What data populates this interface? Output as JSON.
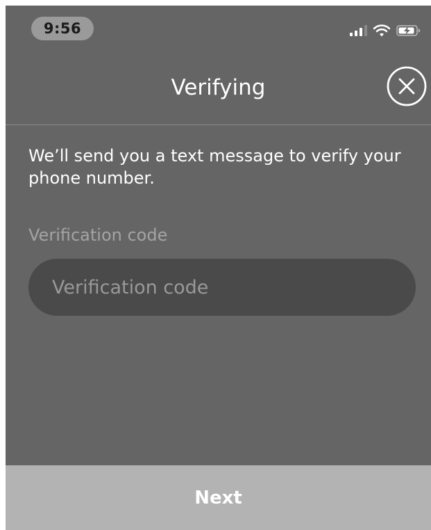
{
  "status_bar": {
    "time": "9:56",
    "icons": [
      "signal-icon",
      "wifi-icon",
      "battery-charging-icon"
    ]
  },
  "header": {
    "title": "Verifying",
    "close_icon": "close-circle-icon"
  },
  "main": {
    "description": "We’ll send you a text message to verify your phone number.",
    "code_field": {
      "label": "Verification code",
      "placeholder": "Verification code",
      "value": ""
    }
  },
  "footer": {
    "next_label": "Next"
  },
  "colors": {
    "screen_background": "#656565",
    "input_background": "#4a4a4a",
    "next_button_background": "#b3b3b3",
    "label_color": "#a4a4a4",
    "text_color": "#ffffff"
  }
}
